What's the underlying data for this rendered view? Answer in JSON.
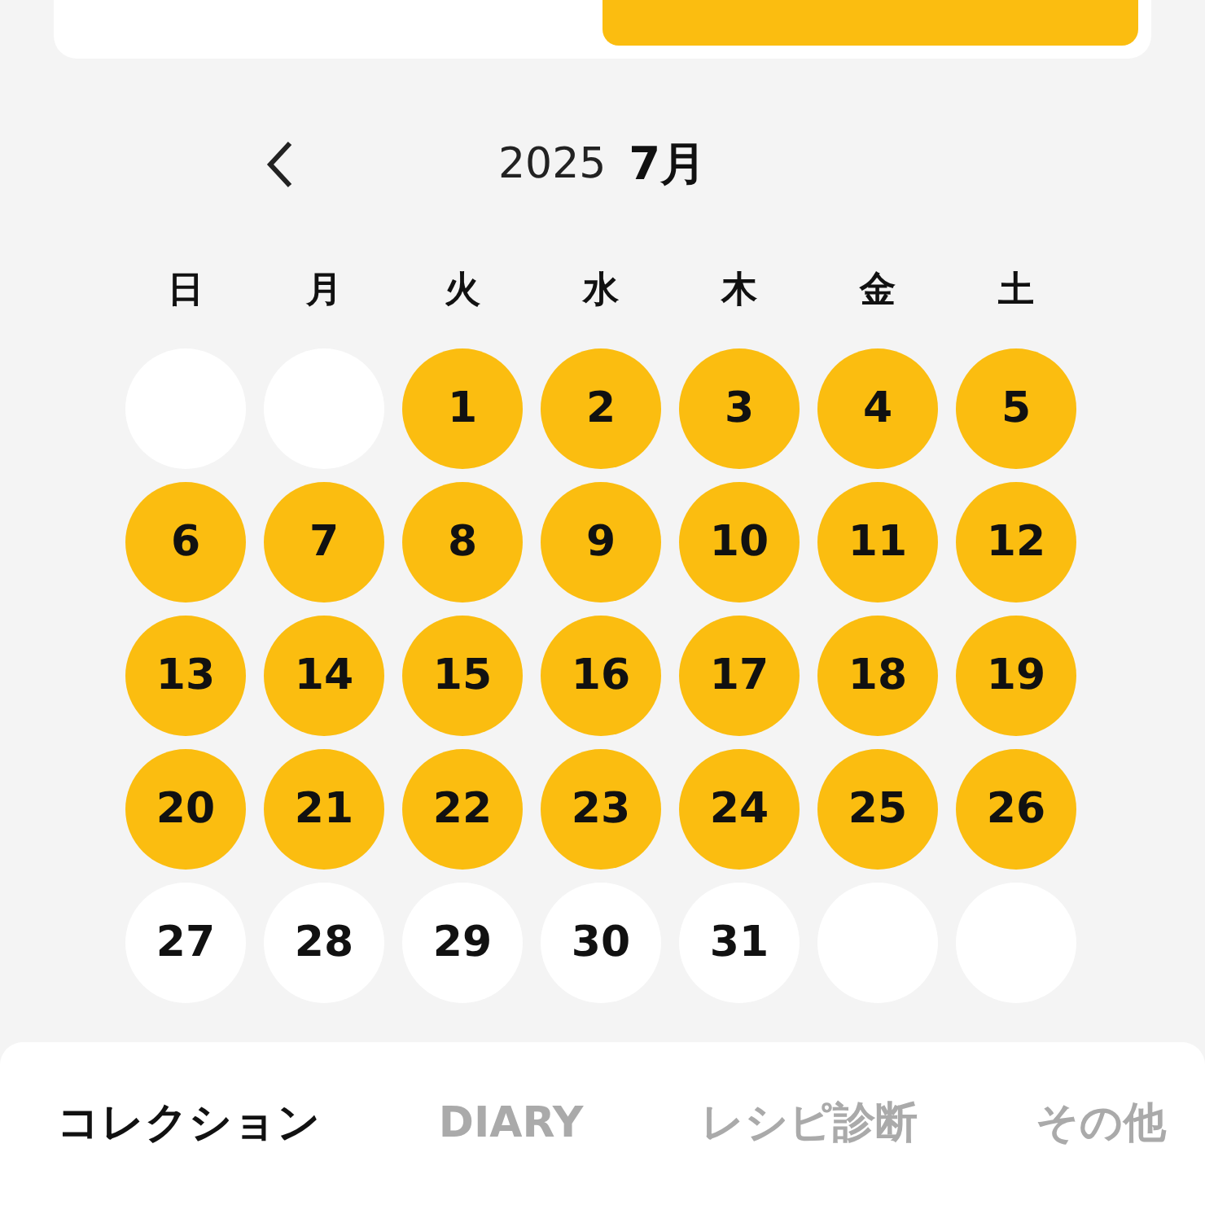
{
  "top_tabs": [
    {
      "selected": false
    },
    {
      "selected": true
    }
  ],
  "calendar": {
    "year": "2025",
    "month": "7月",
    "weekdays": [
      "日",
      "月",
      "火",
      "水",
      "木",
      "金",
      "土"
    ],
    "cells": [
      {
        "kind": "empty"
      },
      {
        "kind": "empty"
      },
      {
        "kind": "day",
        "day": "1",
        "marked": true
      },
      {
        "kind": "day",
        "day": "2",
        "marked": true
      },
      {
        "kind": "day",
        "day": "3",
        "marked": true
      },
      {
        "kind": "day",
        "day": "4",
        "marked": true
      },
      {
        "kind": "day",
        "day": "5",
        "marked": true
      },
      {
        "kind": "day",
        "day": "6",
        "marked": true
      },
      {
        "kind": "day",
        "day": "7",
        "marked": true
      },
      {
        "kind": "day",
        "day": "8",
        "marked": true
      },
      {
        "kind": "day",
        "day": "9",
        "marked": true
      },
      {
        "kind": "day",
        "day": "10",
        "marked": true
      },
      {
        "kind": "day",
        "day": "11",
        "marked": true
      },
      {
        "kind": "day",
        "day": "12",
        "marked": true
      },
      {
        "kind": "day",
        "day": "13",
        "marked": true
      },
      {
        "kind": "day",
        "day": "14",
        "marked": true
      },
      {
        "kind": "day",
        "day": "15",
        "marked": true
      },
      {
        "kind": "day",
        "day": "16",
        "marked": true
      },
      {
        "kind": "day",
        "day": "17",
        "marked": true
      },
      {
        "kind": "day",
        "day": "18",
        "marked": true
      },
      {
        "kind": "day",
        "day": "19",
        "marked": true
      },
      {
        "kind": "day",
        "day": "20",
        "marked": true
      },
      {
        "kind": "day",
        "day": "21",
        "marked": true
      },
      {
        "kind": "day",
        "day": "22",
        "marked": true
      },
      {
        "kind": "day",
        "day": "23",
        "marked": true
      },
      {
        "kind": "day",
        "day": "24",
        "marked": true
      },
      {
        "kind": "day",
        "day": "25",
        "marked": true
      },
      {
        "kind": "day",
        "day": "26",
        "marked": true
      },
      {
        "kind": "day",
        "day": "27",
        "marked": false
      },
      {
        "kind": "day",
        "day": "28",
        "marked": false
      },
      {
        "kind": "day",
        "day": "29",
        "marked": false
      },
      {
        "kind": "day",
        "day": "30",
        "marked": false
      },
      {
        "kind": "day",
        "day": "31",
        "marked": false
      },
      {
        "kind": "empty"
      },
      {
        "kind": "empty"
      }
    ]
  },
  "bottom_tabs": [
    {
      "label": "コレクション",
      "selected": true
    },
    {
      "label": "DIARY",
      "selected": false
    },
    {
      "label": "レシピ診断",
      "selected": false
    },
    {
      "label": "その他",
      "selected": false
    }
  ]
}
